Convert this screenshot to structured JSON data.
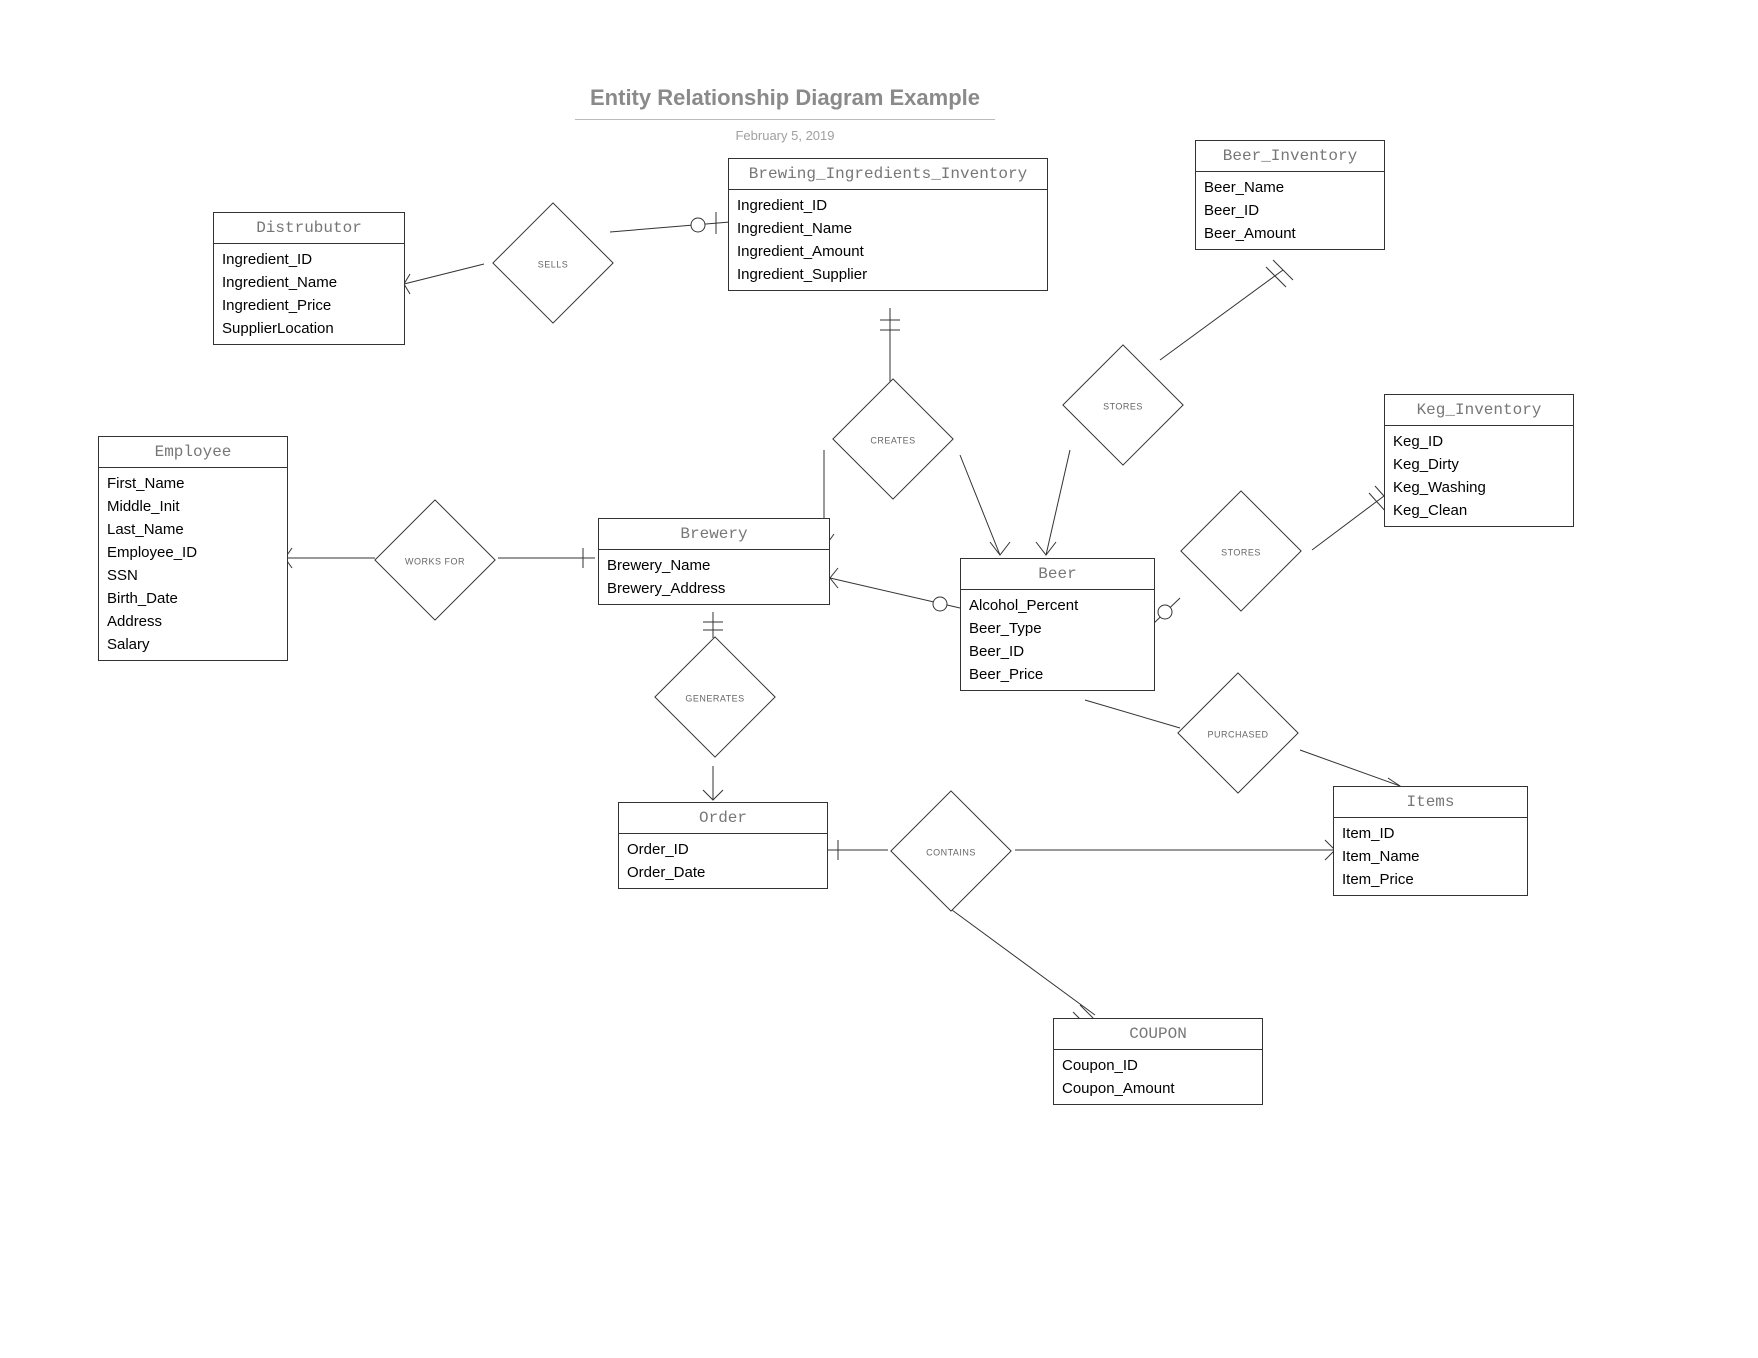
{
  "title": "Entity Relationship Diagram Example",
  "date": "February 5, 2019",
  "entities": {
    "distributor": {
      "name": "Distrubutor",
      "attributes": [
        "Ingredient_ID",
        "Ingredient_Name",
        "Ingredient_Price",
        "SupplierLocation"
      ]
    },
    "brewing_ingredients_inventory": {
      "name": "Brewing_Ingredients_Inventory",
      "attributes": [
        "Ingredient_ID",
        "Ingredient_Name",
        "Ingredient_Amount",
        "Ingredient_Supplier"
      ]
    },
    "beer_inventory": {
      "name": "Beer_Inventory",
      "attributes": [
        "Beer_Name",
        "Beer_ID",
        "Beer_Amount"
      ]
    },
    "employee": {
      "name": "Employee",
      "attributes": [
        "First_Name",
        "Middle_Init",
        "Last_Name",
        "Employee_ID",
        "SSN",
        "Birth_Date",
        "Address",
        "Salary"
      ]
    },
    "brewery": {
      "name": "Brewery",
      "attributes": [
        "Brewery_Name",
        "Brewery_Address"
      ]
    },
    "beer": {
      "name": "Beer",
      "attributes": [
        "Alcohol_Percent",
        "Beer_Type",
        "Beer_ID",
        "Beer_Price"
      ]
    },
    "keg_inventory": {
      "name": "Keg_Inventory",
      "attributes": [
        "Keg_ID",
        "Keg_Dirty",
        "Keg_Washing",
        "Keg_Clean"
      ]
    },
    "order": {
      "name": "Order",
      "attributes": [
        "Order_ID",
        "Order_Date"
      ]
    },
    "items": {
      "name": "Items",
      "attributes": [
        "Item_ID",
        "Item_Name",
        "Item_Price"
      ]
    },
    "coupon": {
      "name": "COUPON",
      "attributes": [
        "Coupon_ID",
        "Coupon_Amount"
      ]
    }
  },
  "relationships": {
    "sells": "SELLS",
    "creates": "CREATES",
    "stores_beer": "STORES",
    "stores_keg": "STORES",
    "works_for": "WORKS FOR",
    "generates": "GENERATES",
    "contains": "CONTAINS",
    "purchased": "PURCHASED"
  }
}
